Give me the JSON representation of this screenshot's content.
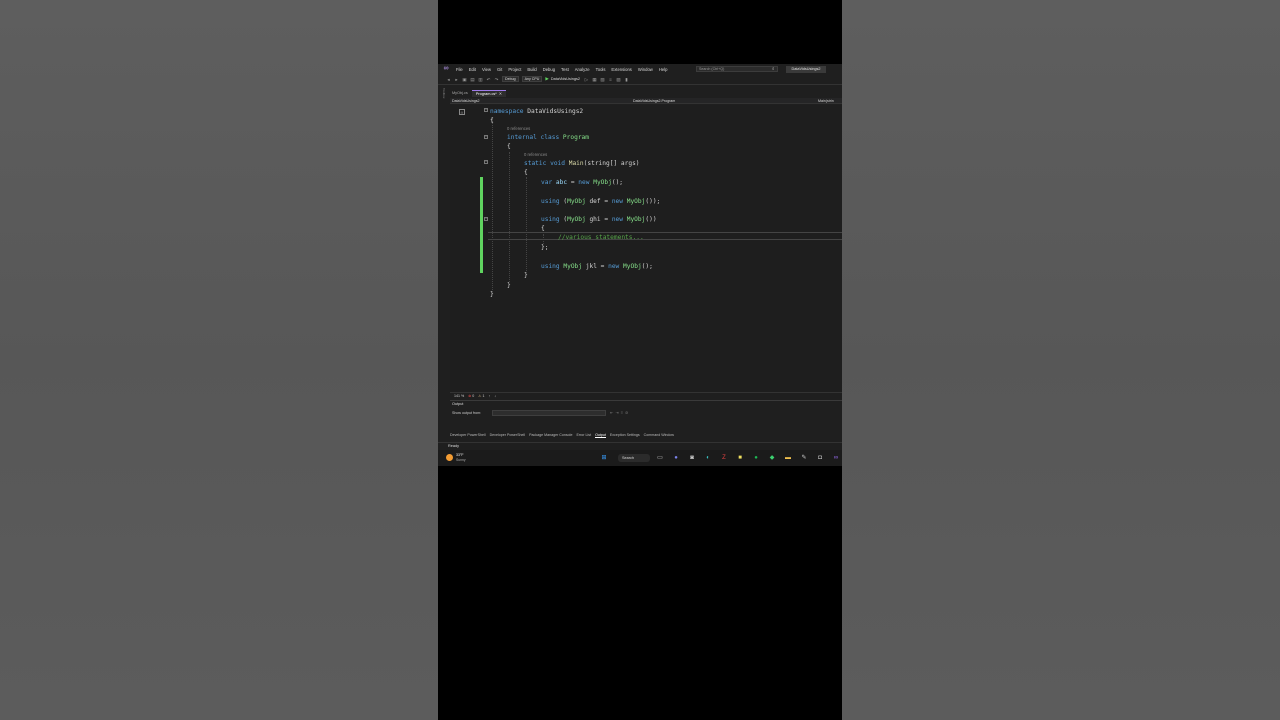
{
  "menu": {
    "items": [
      "File",
      "Edit",
      "View",
      "Git",
      "Project",
      "Build",
      "Debug",
      "Test",
      "Analyze",
      "Tools",
      "Extensions",
      "Window",
      "Help"
    ],
    "search_placeholder": "Search (Ctrl+Q)",
    "solution_name": "DataVidsUsings2"
  },
  "toolbar": {
    "config": "Debug",
    "platform": "Any CPU",
    "start_target": "DataVidsUsings2"
  },
  "tabs": [
    {
      "label": "MyObj.cs",
      "active": false
    },
    {
      "label": "Program.cs*",
      "active": true
    }
  ],
  "side_strip_label": "Toolbox",
  "navbar": {
    "project": "DataVidsUsings2",
    "class": "DataVidsUsings2.Program",
    "member": "Main(strin"
  },
  "code": {
    "l1_kw": "namespace",
    "l1_name": "DataVidsUsings2",
    "open_brace": "{",
    "close_brace": "}",
    "codelens_class": "0 references",
    "l3_kw1": "internal",
    "l3_kw2": "class",
    "l3_name": "Program",
    "codelens_main": "0 references",
    "l5_kw1": "static",
    "l5_kw2": "void",
    "l5_fn": "Main",
    "l5_params": "(string[] args)",
    "l7_var": "var",
    "l7_name": "abc",
    "l7_eq": " = ",
    "l7_new": "new",
    "l7_type": "MyObj",
    "l7_end": "();",
    "l8_using": "using",
    "l8_open": " (",
    "l8_type": "MyObj",
    "l8_name": " def = ",
    "l8_new": "new",
    "l8_ctor": "MyObj",
    "l8_end": "());",
    "l9_using": "using",
    "l9_open": " (",
    "l9_type": "MyObj",
    "l9_name": " ghi = ",
    "l9_new": "new",
    "l9_ctor": "MyObj",
    "l9_end": "())",
    "l11_comment": "//various statements...",
    "l12_end": "};",
    "l13_using": "using",
    "l13_type": "MyObj",
    "l13_name": " jkl = ",
    "l13_new": "new",
    "l13_ctor": "MyObj",
    "l13_end": "();"
  },
  "editor_status": {
    "zoom": "141 %",
    "errors": "0",
    "warnings": "1"
  },
  "output": {
    "title": "Output",
    "show_from_label": "Show output from:"
  },
  "bottom_tabs": [
    "Developer PowerShell",
    "Developer PowerShell",
    "Package Manager Console",
    "Error List",
    "Output",
    "Exception Settings",
    "Command Window"
  ],
  "bottom_active": "Output",
  "status": "Ready",
  "taskbar": {
    "temp": "33°F",
    "condition": "Sunny",
    "search_label": "Search"
  },
  "colors": {
    "accent": "#9f7aea",
    "keyword": "#569cd6",
    "type": "#4ec9b0",
    "comment": "#57a64a",
    "change_bar": "#5fd35f"
  }
}
